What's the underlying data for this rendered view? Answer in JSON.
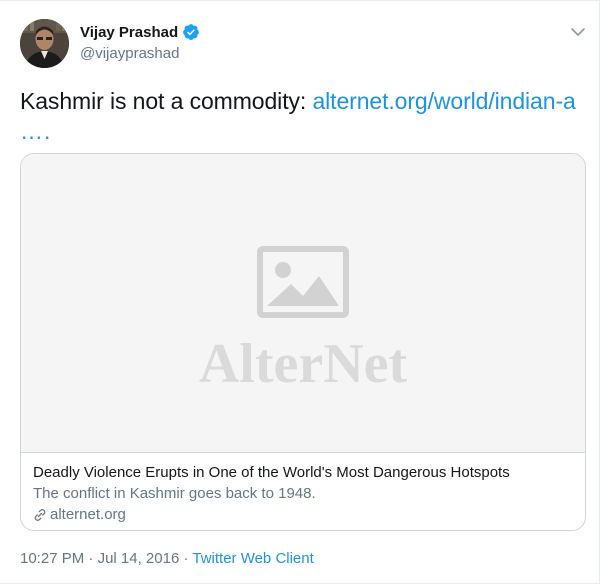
{
  "author": {
    "name": "Vijay Prashad",
    "handle": "@vijayprashad"
  },
  "icons": {
    "verified": "verified-badge-icon",
    "more": "chevron-down-icon",
    "placeholder": "image-placeholder-icon",
    "domain": "link-icon"
  },
  "colors": {
    "link": "#1b95e0",
    "secondary_text": "#657786",
    "primary_text": "#14171a"
  },
  "tweet": {
    "text": "Kashmir is not a commodity: ",
    "link_text": "alternet.org/world/indian-a",
    "link_ellipsis": "….",
    "time": "10:27 PM",
    "separator": " · ",
    "date": "Jul 14, 2016",
    "separator2": " · ",
    "client": "Twitter Web Client"
  },
  "card": {
    "logo_text": "AlterNet",
    "title": "Deadly Violence Erupts in One of the World's Most Dangerous Hotspots",
    "description": "The conflict in Kashmir goes back to 1948.",
    "domain": "alternet.org"
  }
}
